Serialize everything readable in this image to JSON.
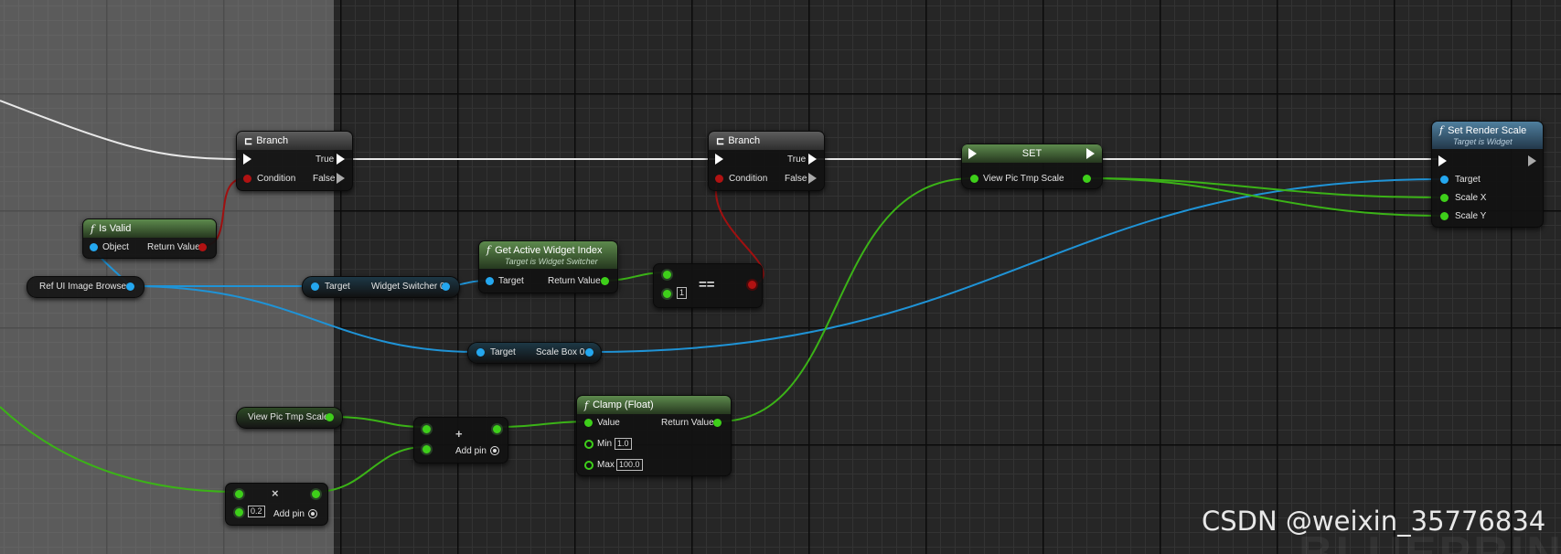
{
  "nodes": {
    "branch1": {
      "title": "Branch",
      "true_label": "True",
      "false_label": "False",
      "condition_label": "Condition"
    },
    "branch2": {
      "title": "Branch",
      "true_label": "True",
      "false_label": "False",
      "condition_label": "Condition"
    },
    "is_valid": {
      "title": "Is Valid",
      "object_label": "Object",
      "return_label": "Return Value"
    },
    "ref_ui": {
      "label": "Ref UI Image Browser"
    },
    "widget_switcher_get": {
      "target_label": "Target",
      "output_label": "Widget Switcher 0"
    },
    "get_active_widget": {
      "title": "Get Active Widget Index",
      "subtitle": "Target is Widget Switcher",
      "target_label": "Target",
      "return_label": "Return Value"
    },
    "equals": {
      "operator": "==",
      "value": "1"
    },
    "scale_box_get": {
      "target_label": "Target",
      "output_label": "Scale Box 0"
    },
    "set_node": {
      "title": "SET",
      "var_label": "View Pic Tmp Scale"
    },
    "set_render_scale": {
      "title": "Set Render Scale",
      "subtitle": "Target is Widget",
      "target_label": "Target",
      "scale_x_label": "Scale X",
      "scale_y_label": "Scale Y"
    },
    "view_pic_var": {
      "label": "View Pic Tmp Scale"
    },
    "add_node": {
      "symbol": "+",
      "add_pin_label": "Add pin"
    },
    "clamp": {
      "title": "Clamp (Float)",
      "value_label": "Value",
      "return_label": "Return Value",
      "min_label": "Min",
      "min_value": "1.0",
      "max_label": "Max",
      "max_value": "100.0"
    },
    "multiply_node": {
      "symbol": "×",
      "value": "0.2",
      "add_pin_label": "Add pin"
    }
  },
  "watermark": "CSDN @weixin_35776834",
  "background_text": "BLUEPRINT",
  "colors": {
    "exec": "#ffffff",
    "bool": "#b11212",
    "float": "#3ecf1a",
    "object": "#24a7ef",
    "comment": "#8f8f8f"
  }
}
